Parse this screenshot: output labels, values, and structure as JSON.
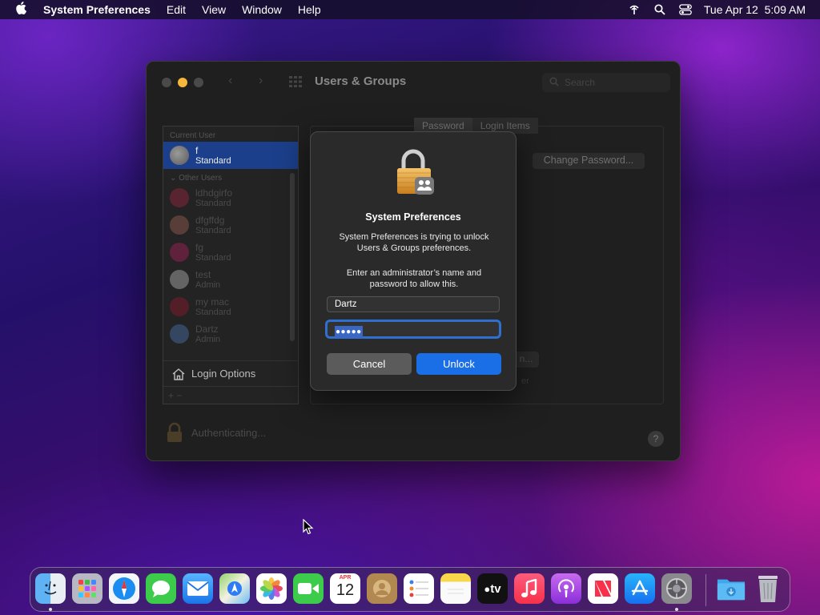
{
  "menubar": {
    "app_name": "System Preferences",
    "items": [
      "Edit",
      "View",
      "Window",
      "Help"
    ],
    "clock": "Tue Apr 12  5:09 AM"
  },
  "window": {
    "title": "Users & Groups",
    "search_placeholder": "Search"
  },
  "sidebar": {
    "current_user_heading": "Current User",
    "current_user": {
      "name": "f",
      "role": "Standard"
    },
    "other_users_heading": "Other Users",
    "other_users": [
      {
        "name": "ldhdgirfo",
        "role": "Standard"
      },
      {
        "name": "dfgffdg",
        "role": "Standard"
      },
      {
        "name": "fg",
        "role": "Standard"
      },
      {
        "name": "test",
        "role": "Admin"
      },
      {
        "name": "my mac",
        "role": "Standard"
      },
      {
        "name": "Dartz",
        "role": "Admin"
      }
    ],
    "login_options_label": "Login Options",
    "bottom_controls": "+ −"
  },
  "panel": {
    "tabs": [
      "Password",
      "Login Items"
    ],
    "change_password_label": "Change Password...",
    "partial_button_label": "n...",
    "partial_text": "er"
  },
  "footer": {
    "status_text": "Authenticating...",
    "help_label": "?"
  },
  "dialog": {
    "title": "System Preferences",
    "message": "System Preferences is trying to unlock Users & Groups preferences.",
    "prompt": "Enter an administrator’s name and password to allow this.",
    "username_value": "Dartz",
    "password_mask": "●●●●●",
    "cancel_label": "Cancel",
    "unlock_label": "Unlock"
  },
  "dock": {
    "calendar_month": "APR",
    "calendar_day": "12",
    "tv_label": "tv",
    "apps": [
      "Finder",
      "Launchpad",
      "Safari",
      "Messages",
      "Mail",
      "Maps",
      "Photos",
      "FaceTime",
      "Calendar",
      "Contacts",
      "Reminders",
      "Notes",
      "TV",
      "Music",
      "Podcasts",
      "News",
      "App Store",
      "System Preferences",
      "Downloads",
      "Trash"
    ]
  },
  "colors": {
    "accent_blue": "#1a6fe6",
    "selection_blue": "#1b3f8a",
    "lock_gold": "#e8a646"
  }
}
